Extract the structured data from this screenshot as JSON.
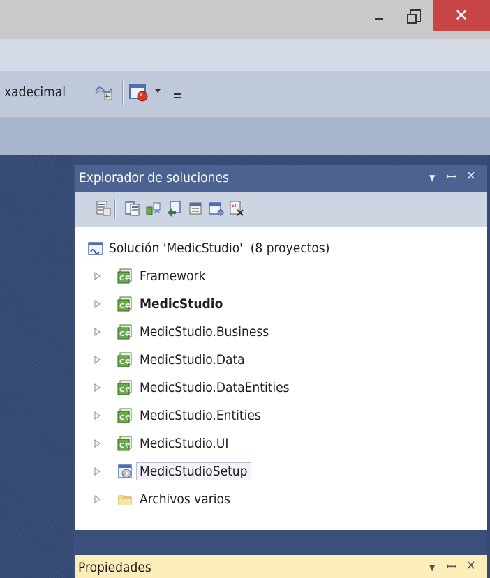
{
  "window": {
    "minimize_icon": "minimize-icon",
    "maximize_icon": "restore-icon",
    "close_glyph": "✕"
  },
  "toolbar": {
    "partial_label": "xadecimal"
  },
  "solution_explorer": {
    "title": "Explorador de soluciones",
    "root_label": "Solución 'MedicStudio'  (8 proyectos)",
    "items": [
      {
        "label": "Framework",
        "icon": "csharp-project-icon",
        "bold": false
      },
      {
        "label": "MedicStudio",
        "icon": "csharp-project-icon",
        "bold": true
      },
      {
        "label": "MedicStudio.Business",
        "icon": "csharp-project-icon",
        "bold": false
      },
      {
        "label": "MedicStudio.Data",
        "icon": "csharp-project-icon",
        "bold": false
      },
      {
        "label": "MedicStudio.DataEntities",
        "icon": "csharp-project-icon",
        "bold": false
      },
      {
        "label": "MedicStudio.Entities",
        "icon": "csharp-project-icon",
        "bold": false
      },
      {
        "label": "MedicStudio.UI",
        "icon": "csharp-project-icon",
        "bold": false
      },
      {
        "label": "MedicStudioSetup",
        "icon": "setup-project-icon",
        "bold": false
      },
      {
        "label": "Archivos varios",
        "icon": "folder-icon",
        "bold": false
      }
    ]
  },
  "properties": {
    "title": "Propiedades"
  },
  "colors": {
    "panel_header": "#4c6392",
    "properties_header": "#fbeeb8",
    "close_button": "#c84545",
    "background": "#344a75"
  }
}
